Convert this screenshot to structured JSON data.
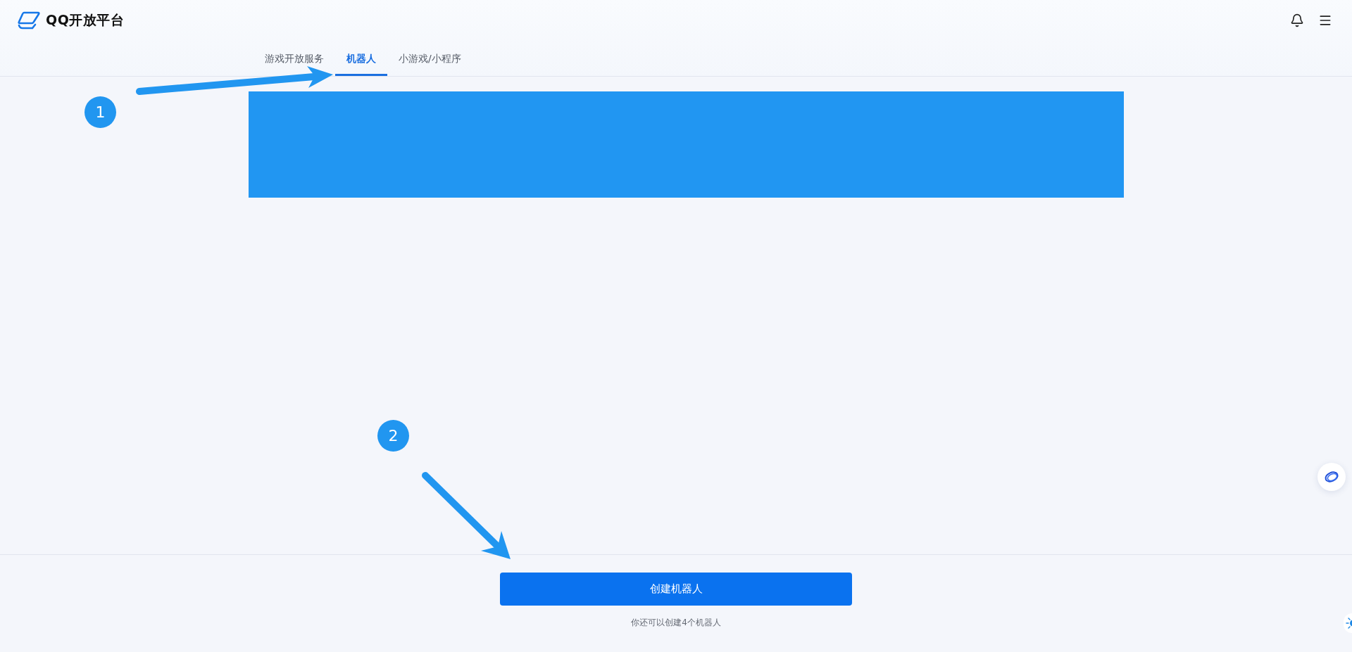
{
  "header": {
    "logo_text": "QQ开放平台"
  },
  "tabs": [
    {
      "label": "游戏开放服务",
      "selected": false
    },
    {
      "label": "机器人",
      "selected": true
    },
    {
      "label": "小游戏/小程序",
      "selected": false
    }
  ],
  "annotations": [
    {
      "number": "1"
    },
    {
      "number": "2"
    }
  ],
  "footer": {
    "button": "创建机器人",
    "note": "你还可以创建4个机器人"
  }
}
